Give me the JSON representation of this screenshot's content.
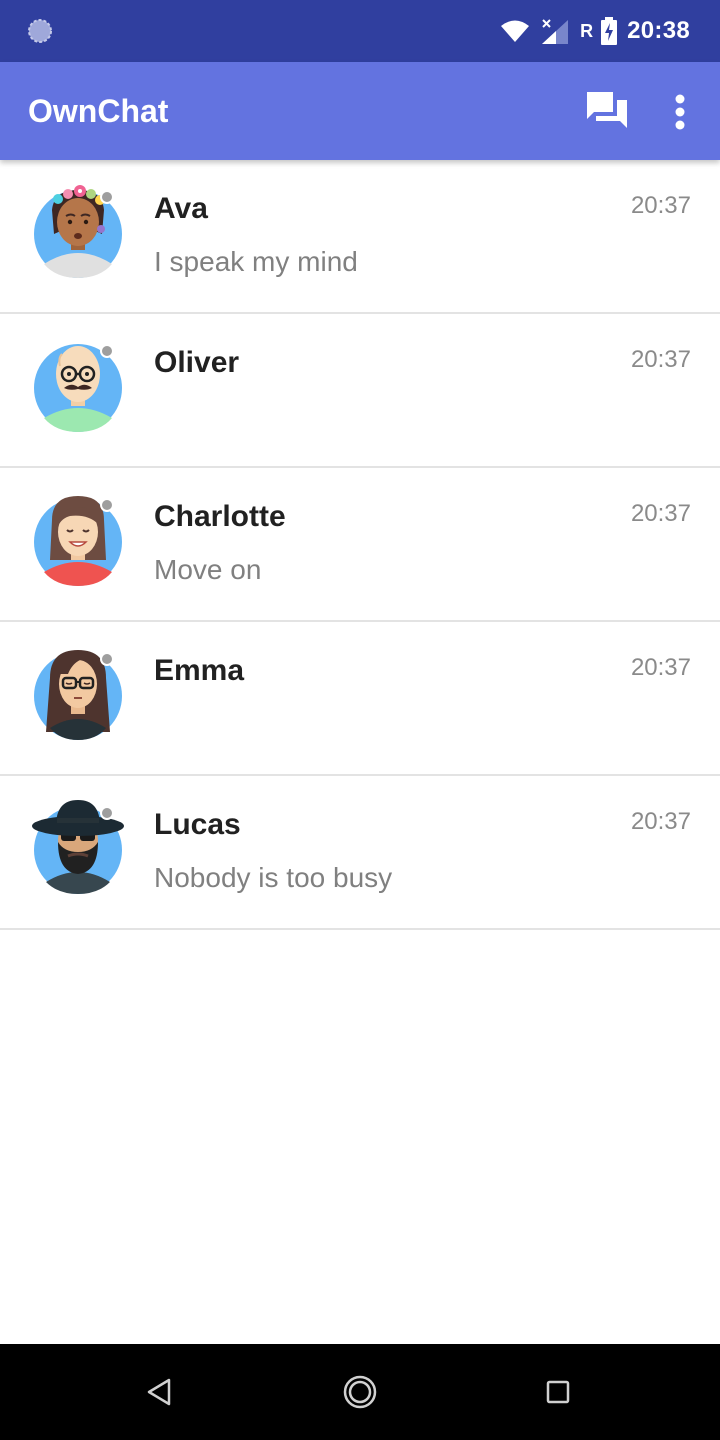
{
  "status_bar": {
    "time": "20:38",
    "roaming_label": "R",
    "icons": [
      "sync-icon",
      "wifi-icon",
      "signal-icon",
      "battery-charging-icon"
    ]
  },
  "app_bar": {
    "title": "OwnChat",
    "actions": [
      "chat-bubbles-icon",
      "more-vert-icon"
    ],
    "background_color": "#6373e0"
  },
  "chats": [
    {
      "name": "Ava",
      "message": "I speak my mind",
      "time": "20:37",
      "avatar": "avatar-ava-flower-crown-icon"
    },
    {
      "name": "Oliver",
      "message": "",
      "time": "20:37",
      "avatar": "avatar-oliver-glasses-mustache-icon"
    },
    {
      "name": "Charlotte",
      "message": "Move on",
      "time": "20:37",
      "avatar": "avatar-charlotte-icon"
    },
    {
      "name": "Emma",
      "message": "",
      "time": "20:37",
      "avatar": "avatar-emma-glasses-icon"
    },
    {
      "name": "Lucas",
      "message": "Nobody is too busy",
      "time": "20:37",
      "avatar": "avatar-lucas-hat-beard-icon"
    }
  ],
  "nav_bar": {
    "buttons": [
      "back-icon",
      "home-icon",
      "recents-icon"
    ]
  },
  "colors": {
    "status_bar": "#303f9f",
    "presence_offline": "#9e9e9e",
    "avatar_background": "#64b5f6"
  }
}
